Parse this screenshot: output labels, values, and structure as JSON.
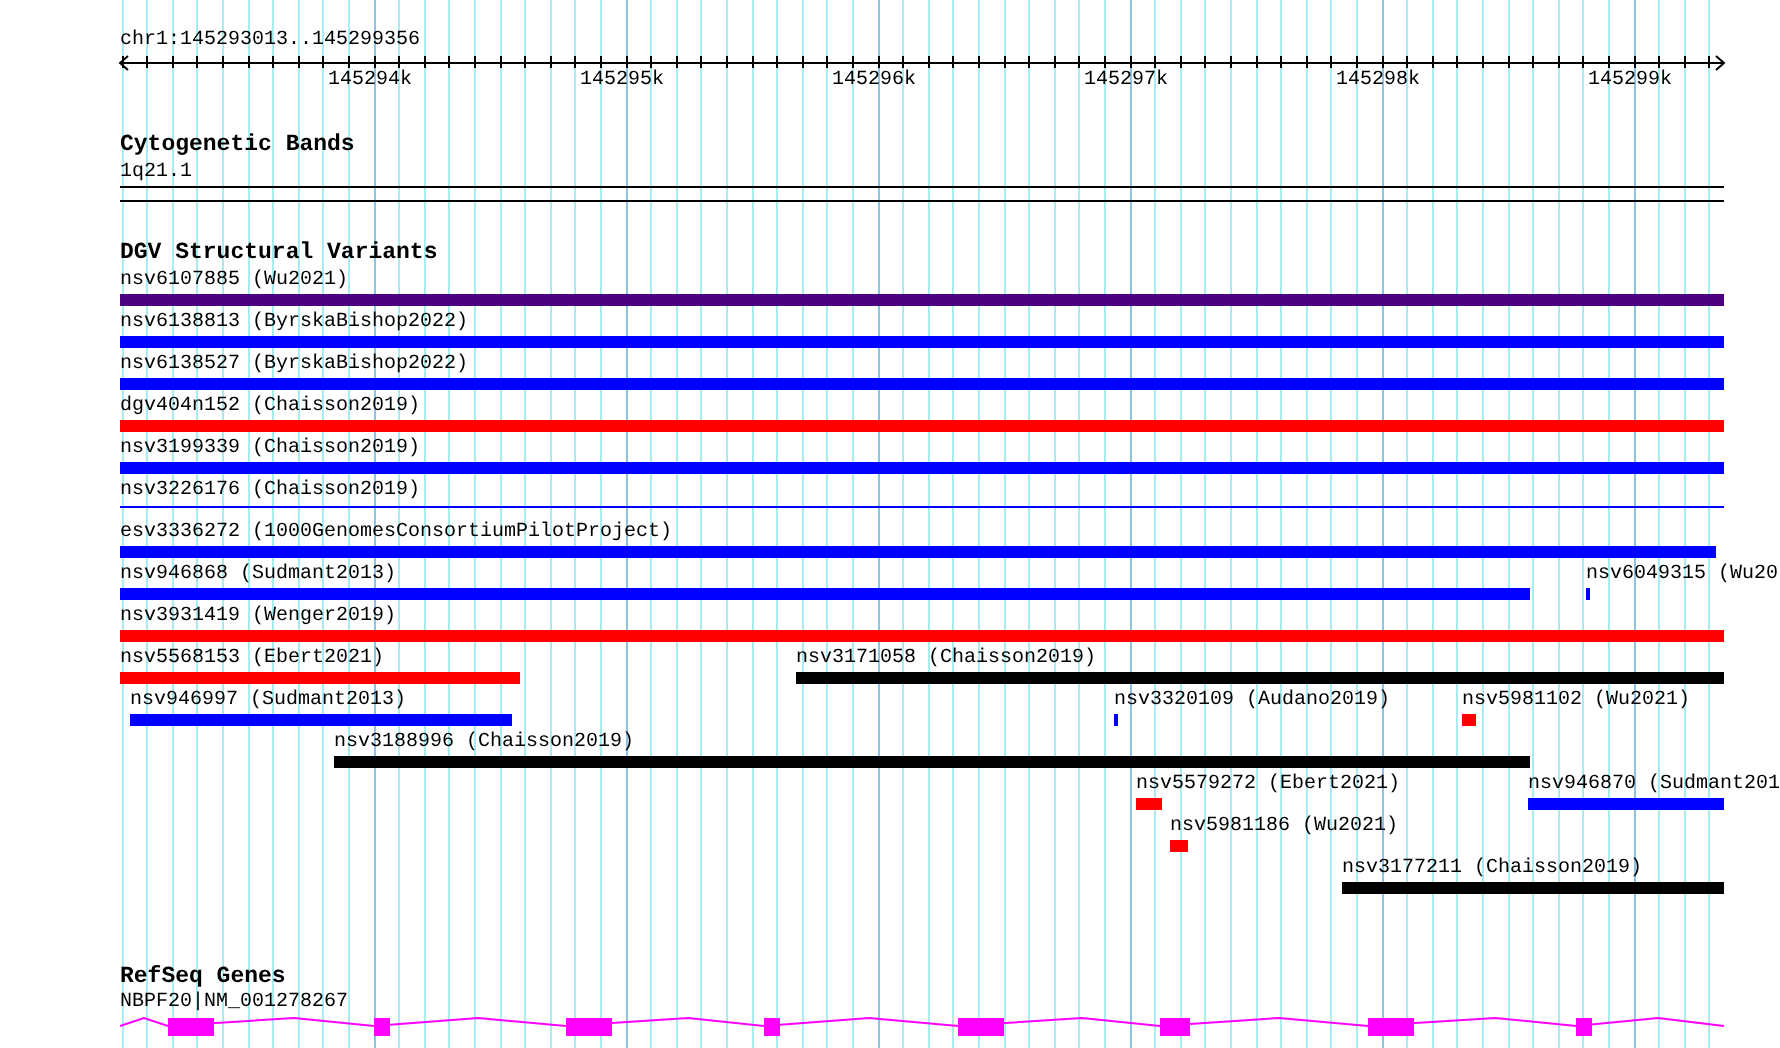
{
  "ruler": {
    "location": "chr1:145293013..145299356",
    "ticks": [
      "145294k",
      "145295k",
      "145296k",
      "145297k",
      "145298k",
      "145299k"
    ]
  },
  "cytogenetic_bands": {
    "title": "Cytogenetic Bands",
    "band": "1q21.1"
  },
  "dgv_structural_variants": {
    "title": "DGV Structural Variants",
    "features": [
      {
        "label": "nsv6107885 (Wu2021)",
        "color": "#4b0082"
      },
      {
        "label": "nsv6138813 (ByrskaBishop2022)",
        "color": "#0000ff"
      },
      {
        "label": "nsv6138527 (ByrskaBishop2022)",
        "color": "#0000ff"
      },
      {
        "label": "dgv404n152 (Chaisson2019)",
        "color": "#ff0000"
      },
      {
        "label": "nsv3199339 (Chaisson2019)",
        "color": "#0000ff"
      },
      {
        "label": "nsv3226176 (Chaisson2019)",
        "color": "#0000ff"
      },
      {
        "label": "esv3336272 (1000GenomesConsortiumPilotProject)",
        "color": "#0000ff"
      },
      {
        "label": "nsv946868 (Sudmant2013)",
        "color": "#0000ff"
      },
      {
        "label": "nsv6049315 (Wu20",
        "color": "#0000ff"
      },
      {
        "label": "nsv3931419 (Wenger2019)",
        "color": "#ff0000"
      },
      {
        "label": "nsv5568153 (Ebert2021)",
        "color": "#ff0000"
      },
      {
        "label": "nsv3171058 (Chaisson2019)",
        "color": "#000000"
      },
      {
        "label": "nsv946997 (Sudmant2013)",
        "color": "#0000ff"
      },
      {
        "label": "nsv3320109 (Audano2019)",
        "color": "#0000ff"
      },
      {
        "label": "nsv5981102 (Wu2021)",
        "color": "#ff0000"
      },
      {
        "label": "nsv3188996 (Chaisson2019)",
        "color": "#000000"
      },
      {
        "label": "nsv5579272 (Ebert2021)",
        "color": "#ff0000"
      },
      {
        "label": "nsv946870 (Sudmant201",
        "color": "#0000ff"
      },
      {
        "label": "nsv5981186 (Wu2021)",
        "color": "#ff0000"
      },
      {
        "label": "nsv3177211 (Chaisson2019)",
        "color": "#000000"
      }
    ]
  },
  "refseq_genes": {
    "title": "RefSeq Genes",
    "gene": "NBPF20|NM_001278267"
  }
}
